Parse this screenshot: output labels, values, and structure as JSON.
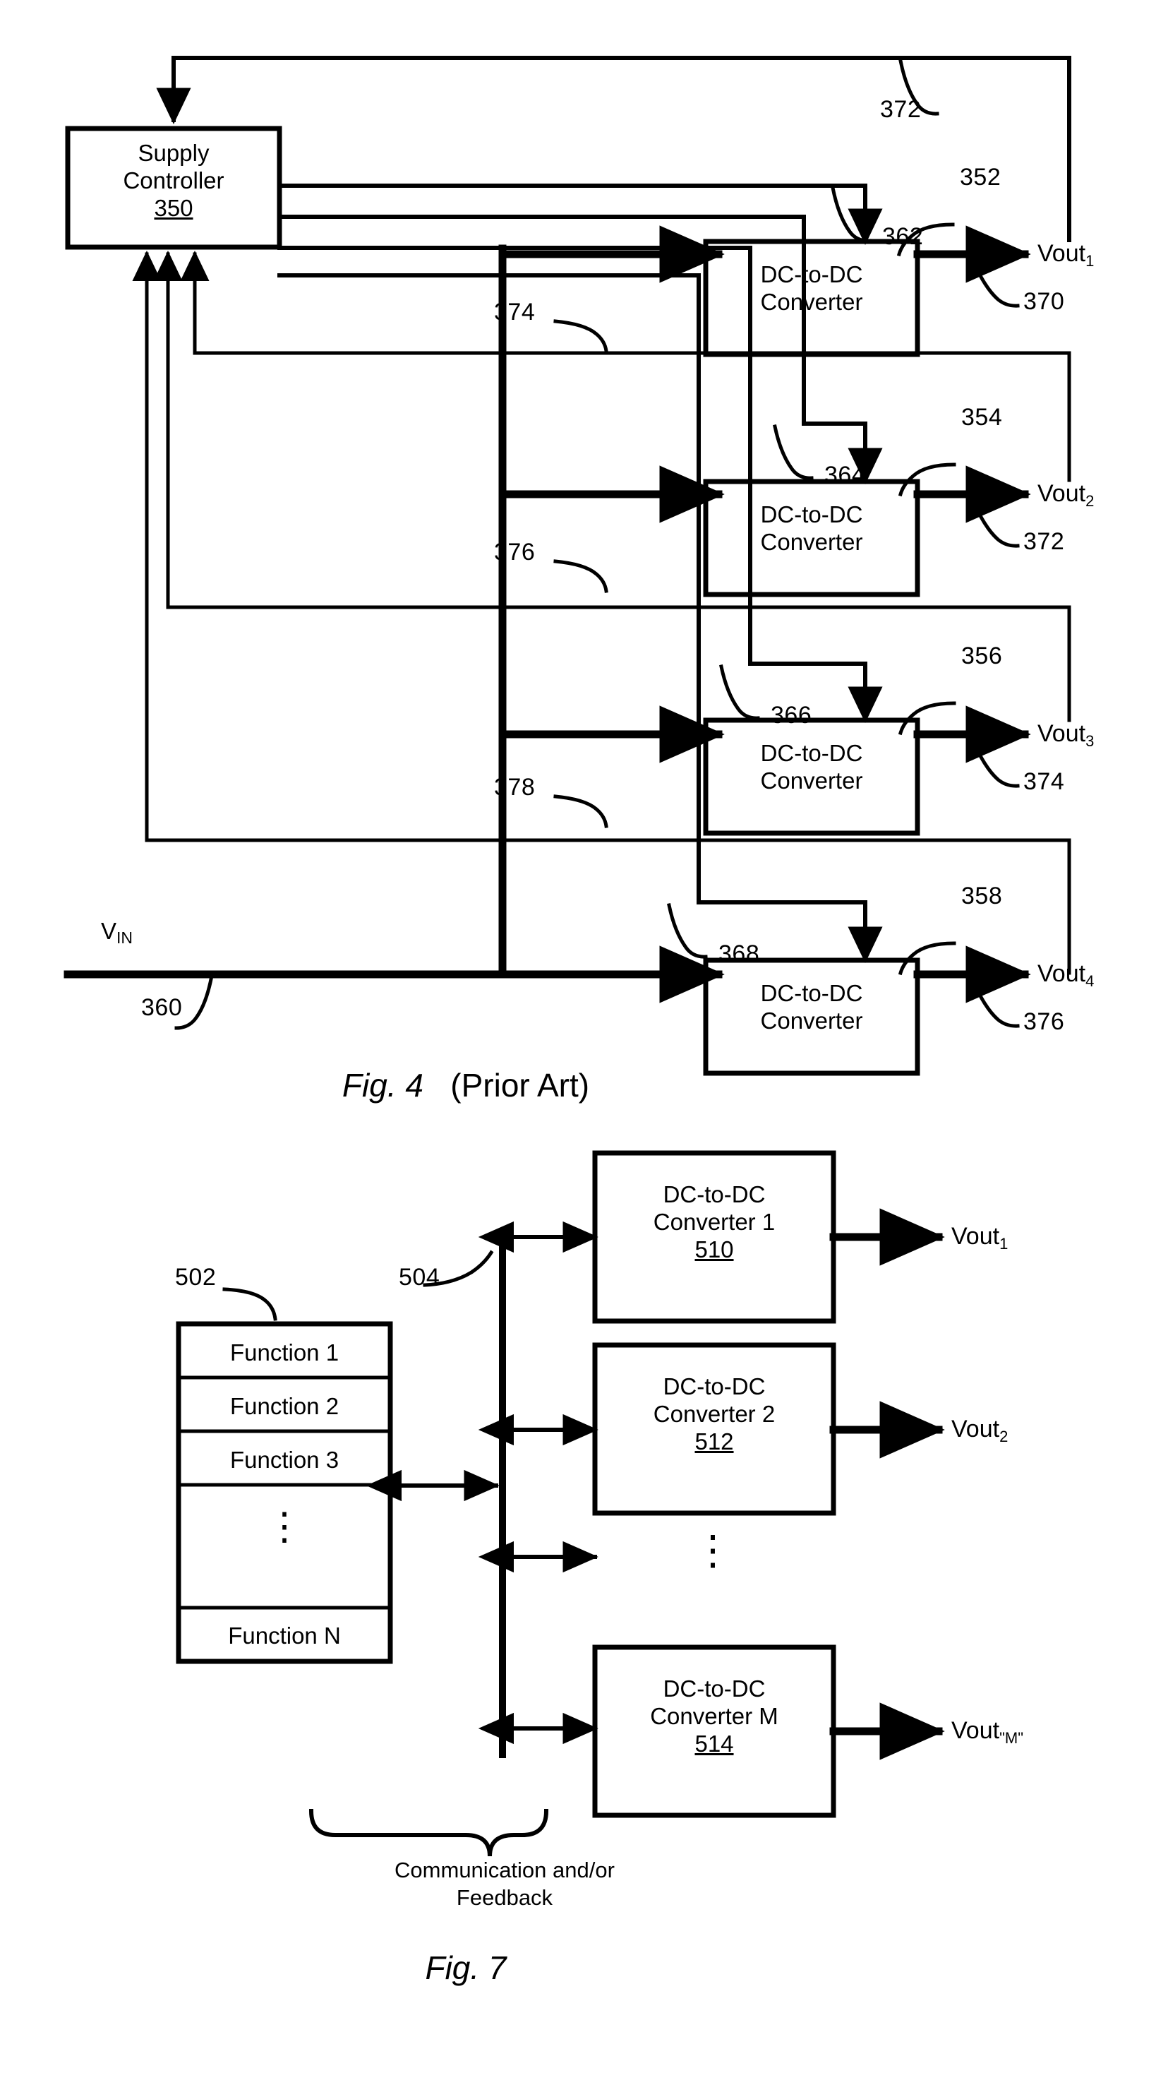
{
  "figure4": {
    "caption_italic": "Fig. 4",
    "caption_normal": "(Prior Art)",
    "supply_controller": {
      "line1": "Supply",
      "line2": "Controller",
      "ref": "350"
    },
    "vin_label": "V",
    "vin_sub": "IN",
    "vin_bus_ref": "360",
    "converters": [
      {
        "line1": "DC-to-DC",
        "line2": "Converter",
        "ref": "352",
        "ctrl_ref": "362",
        "fb_ref": "372",
        "out_ref": "370",
        "out_label": "Vout",
        "out_sub": "1"
      },
      {
        "line1": "DC-to-DC",
        "line2": "Converter",
        "ref": "354",
        "ctrl_ref": "364",
        "fb_ref": "374",
        "out_ref": "372",
        "out_label": "Vout",
        "out_sub": "2"
      },
      {
        "line1": "DC-to-DC",
        "line2": "Converter",
        "ref": "356",
        "ctrl_ref": "366",
        "fb_ref": "376",
        "out_ref": "374",
        "out_label": "Vout",
        "out_sub": "3"
      },
      {
        "line1": "DC-to-DC",
        "line2": "Converter",
        "ref": "358",
        "ctrl_ref": "368",
        "fb_ref": "378",
        "out_ref": "376",
        "out_label": "Vout",
        "out_sub": "4"
      }
    ]
  },
  "figure7": {
    "caption_italic": "Fig. 7",
    "function_block": {
      "ref": "502",
      "items": [
        "Function 1",
        "Function 2",
        "Function 3",
        "Function N"
      ],
      "vertical_dots": "⋮"
    },
    "bus_ref": "504",
    "bus_caption_line1": "Communication and/or",
    "bus_caption_line2": "Feedback",
    "converters": [
      {
        "line1": "DC-to-DC",
        "line2": "Converter 1",
        "ref": "510",
        "out_label": "Vout",
        "out_sub": "1"
      },
      {
        "line1": "DC-to-DC",
        "line2": "Converter 2",
        "ref": "512",
        "out_label": "Vout",
        "out_sub": "2"
      },
      {
        "line1": "DC-to-DC",
        "line2": "Converter M",
        "ref": "514",
        "out_label": "Vout",
        "out_sub": "\"M\""
      }
    ],
    "ellipsis_dots": "⋮"
  }
}
